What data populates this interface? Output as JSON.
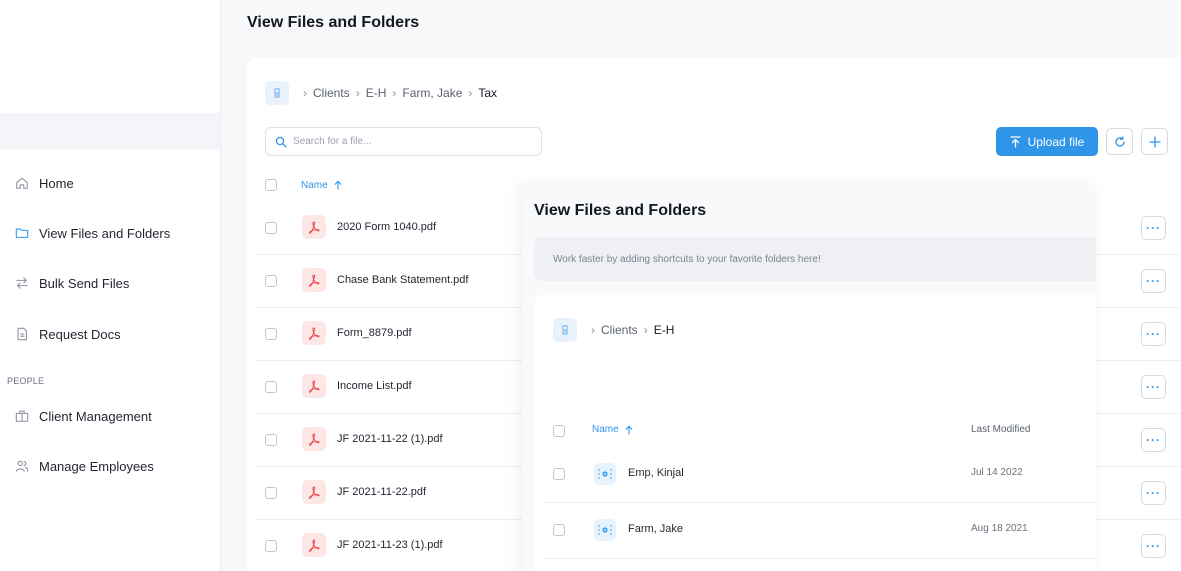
{
  "sidebar": {
    "items": [
      {
        "label": "Home",
        "icon": "home-icon"
      },
      {
        "label": "View Files and Folders",
        "icon": "folder-icon"
      },
      {
        "label": "Bulk Send Files",
        "icon": "transfer-icon"
      },
      {
        "label": "Request Docs",
        "icon": "document-icon"
      }
    ],
    "section_label": "PEOPLE",
    "people_items": [
      {
        "label": "Client Management",
        "icon": "briefcase-icon"
      },
      {
        "label": "Manage Employees",
        "icon": "users-icon"
      }
    ]
  },
  "main": {
    "title": "View Files and Folders",
    "breadcrumb": [
      "Clients",
      "E-H",
      "Farm, Jake",
      "Tax"
    ],
    "search": {
      "placeholder": "Search for a file...",
      "value": ""
    },
    "upload_label": "Upload file",
    "column_name": "Name",
    "files": [
      {
        "name": "2020 Form 1040.pdf"
      },
      {
        "name": "Chase Bank Statement.pdf"
      },
      {
        "name": "Form_8879.pdf"
      },
      {
        "name": "Income List.pdf"
      },
      {
        "name": "JF 2021-11-22 (1).pdf"
      },
      {
        "name": "JF 2021-11-22.pdf"
      },
      {
        "name": "JF 2021-11-23 (1).pdf"
      }
    ],
    "more_label": "···"
  },
  "overlay": {
    "title": "View Files and Folders",
    "hint": "Work faster by adding shortcuts to your favorite folders here!",
    "breadcrumb": [
      "Clients",
      "E-H"
    ],
    "column_name": "Name",
    "column_modified": "Last Modified",
    "folders": [
      {
        "name": "Emp, Kinjal",
        "modified": "Jul 14 2022"
      },
      {
        "name": "Farm, Jake",
        "modified": "Aug 18 2021"
      }
    ]
  },
  "colors": {
    "accent": "#2f95e9",
    "pdf": "#e8484d",
    "folder": "#3a9bea"
  }
}
